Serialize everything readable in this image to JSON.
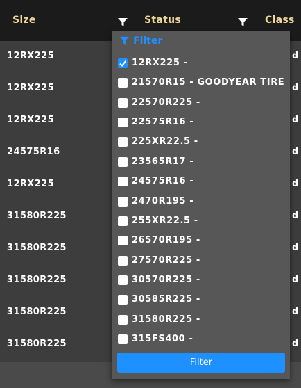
{
  "header": {
    "col_size": "Size",
    "col_status": "Status",
    "col_class": "Class",
    "filter_icon": "filter-icon"
  },
  "rows": [
    {
      "size": "12RX225",
      "cls": "d"
    },
    {
      "size": "12RX225",
      "cls": "d"
    },
    {
      "size": "12RX225",
      "cls": "d"
    },
    {
      "size": "24575R16",
      "cls": "d"
    },
    {
      "size": "12RX225",
      "cls": "d"
    },
    {
      "size": "31580R225",
      "cls": "d"
    },
    {
      "size": "31580R225",
      "cls": "d"
    },
    {
      "size": "31580R225",
      "cls": "d"
    },
    {
      "size": "31580R225",
      "cls": "d"
    },
    {
      "size": "31580R225",
      "cls": "d"
    }
  ],
  "filter_popup": {
    "title": "Filter",
    "options": [
      {
        "label": "12RX225 -",
        "checked": true
      },
      {
        "label": "21570R15 - GOODYEAR TIRE",
        "checked": false
      },
      {
        "label": "22570R225 -",
        "checked": false
      },
      {
        "label": "22575R16 -",
        "checked": false
      },
      {
        "label": "225XR22.5 -",
        "checked": false
      },
      {
        "label": "23565R17 -",
        "checked": false
      },
      {
        "label": "24575R16 -",
        "checked": false
      },
      {
        "label": "2470R195 -",
        "checked": false
      },
      {
        "label": "255XR22.5 -",
        "checked": false
      },
      {
        "label": "26570R195 -",
        "checked": false
      },
      {
        "label": "27570R225 -",
        "checked": false
      },
      {
        "label": "30570R225 -",
        "checked": false
      },
      {
        "label": "30585R225 -",
        "checked": false
      },
      {
        "label": "31580R225 -",
        "checked": false
      },
      {
        "label": "315FS400 -",
        "checked": false
      }
    ],
    "button_label": "Filter"
  },
  "colors": {
    "accent": "#1e90ff",
    "header_text": "#f0d79a",
    "header_bg": "#1b1b1b",
    "popup_bg": "#575757"
  }
}
